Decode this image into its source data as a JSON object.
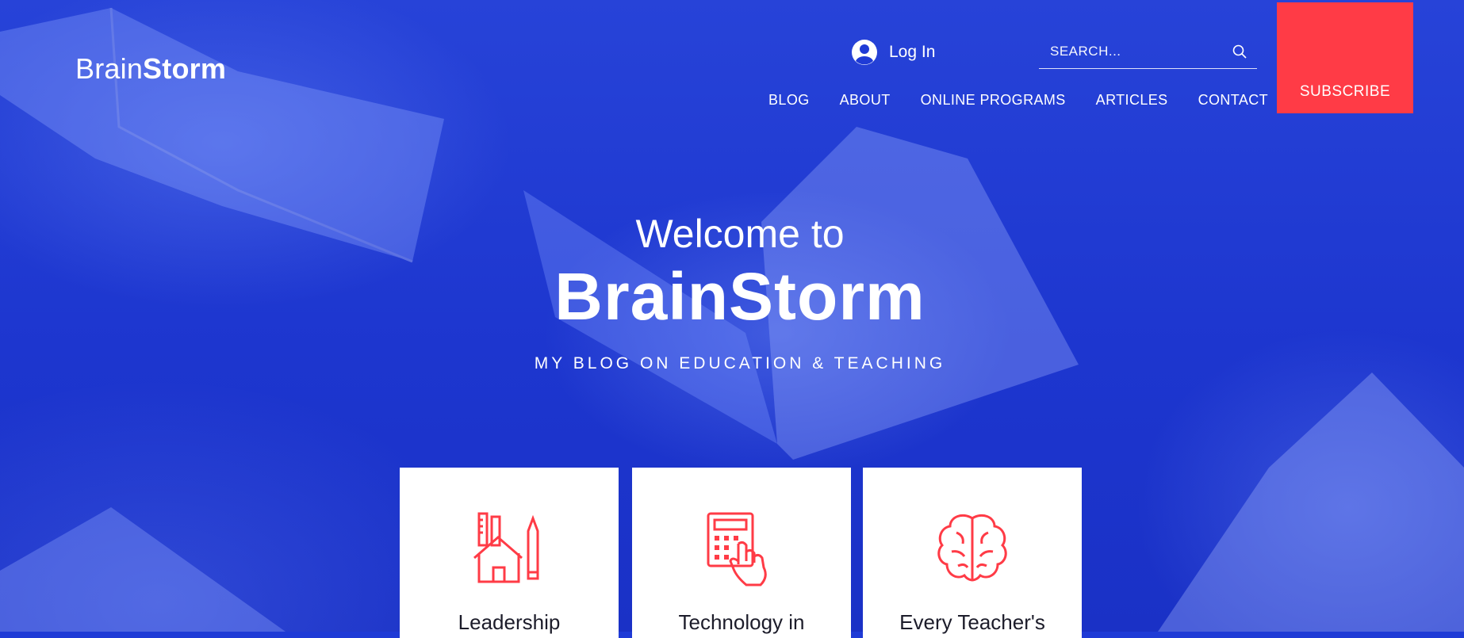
{
  "brand": {
    "name_light": "Brain",
    "name_bold": "Storm"
  },
  "header": {
    "login_label": "Log In",
    "search_placeholder": "SEARCH...",
    "subscribe_label": "SUBSCRIBE",
    "nav": [
      {
        "label": "BLOG"
      },
      {
        "label": "ABOUT"
      },
      {
        "label": "ONLINE PROGRAMS"
      },
      {
        "label": "ARTICLES"
      },
      {
        "label": "CONTACT"
      }
    ]
  },
  "hero": {
    "welcome": "Welcome to",
    "title": "BrainStorm",
    "tagline": "MY BLOG ON EDUCATION & TEACHING"
  },
  "cards": [
    {
      "label": "Leadership",
      "icon": "school-ruler-pencil-icon"
    },
    {
      "label": "Technology in",
      "icon": "calculator-hand-icon"
    },
    {
      "label": "Every Teacher's",
      "icon": "brain-icon"
    }
  ],
  "colors": {
    "hero_blue": "#1f3bd6",
    "accent_red": "#ff3b46",
    "card_bg": "#ffffff",
    "text_white": "#ffffff"
  }
}
